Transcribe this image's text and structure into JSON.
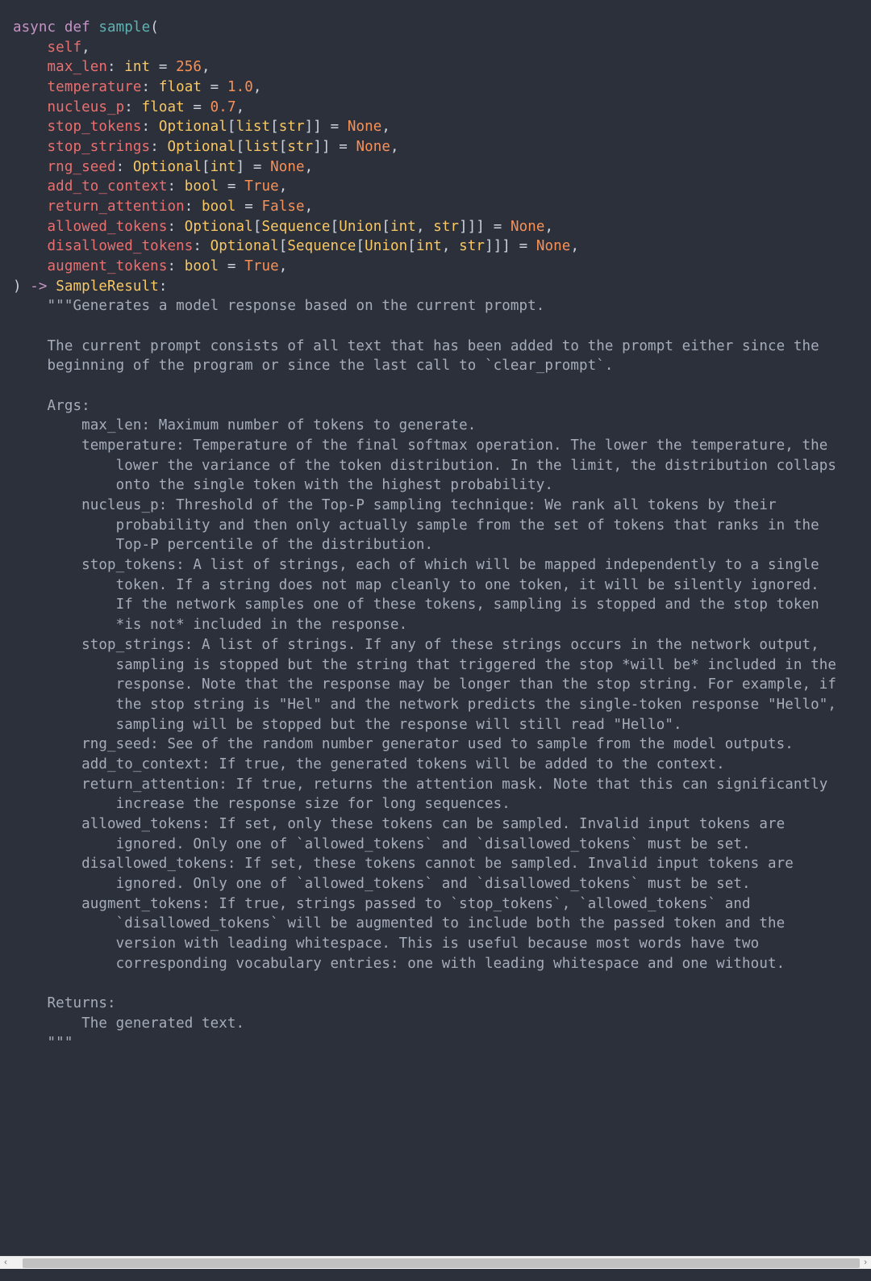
{
  "code": {
    "l1_async": "async",
    "l1_def": "def",
    "l1_fn": "sample",
    "l1_open": "(",
    "l2_self": "self",
    "l3_param": "max_len",
    "l3_type": "int",
    "l3_val": "256",
    "l4_param": "temperature",
    "l4_type": "float",
    "l4_val": "1.0",
    "l5_param": "nucleus_p",
    "l5_type": "float",
    "l5_val": "0.7",
    "l6_param": "stop_tokens",
    "l6_opt": "Optional",
    "l6_list": "list",
    "l6_str": "str",
    "l6_val": "None",
    "l7_param": "stop_strings",
    "l7_opt": "Optional",
    "l7_list": "list",
    "l7_str": "str",
    "l7_val": "None",
    "l8_param": "rng_seed",
    "l8_opt": "Optional",
    "l8_int": "int",
    "l8_val": "None",
    "l9_param": "add_to_context",
    "l9_type": "bool",
    "l9_val": "True",
    "l10_param": "return_attention",
    "l10_type": "bool",
    "l10_val": "False",
    "l11_param": "allowed_tokens",
    "l11_opt": "Optional",
    "l11_seq": "Sequence",
    "l11_union": "Union",
    "l11_int": "int",
    "l11_str": "str",
    "l11_val": "None",
    "l12_param": "disallowed_tokens",
    "l12_opt": "Optional",
    "l12_seq": "Sequence",
    "l12_union": "Union",
    "l12_int": "int",
    "l12_str": "str",
    "l12_val": "None",
    "l13_param": "augment_tokens",
    "l13_type": "bool",
    "l13_val": "True",
    "l14_close": ")",
    "l14_arrow": "->",
    "l14_ret": "SampleResult",
    "doc_open": "\"\"\"Generates a model response based on the current prompt.",
    "doc_p2a": "    The current prompt consists of all text that has been added to the prompt either since the",
    "doc_p2b": "    beginning of the program or since the last call to `clear_prompt`.",
    "doc_args": "    Args:",
    "doc_maxlen": "        max_len: Maximum number of tokens to generate.",
    "doc_temp1": "        temperature: Temperature of the final softmax operation. The lower the temperature, the",
    "doc_temp2": "            lower the variance of the token distribution. In the limit, the distribution collaps",
    "doc_temp3": "            onto the single token with the highest probability.",
    "doc_nuc1": "        nucleus_p: Threshold of the Top-P sampling technique: We rank all tokens by their",
    "doc_nuc2": "            probability and then only actually sample from the set of tokens that ranks in the",
    "doc_nuc3": "            Top-P percentile of the distribution.",
    "doc_st1": "        stop_tokens: A list of strings, each of which will be mapped independently to a single",
    "doc_st2": "            token. If a string does not map cleanly to one token, it will be silently ignored.",
    "doc_st3": "            If the network samples one of these tokens, sampling is stopped and the stop token",
    "doc_st4": "            *is not* included in the response.",
    "doc_ss1": "        stop_strings: A list of strings. If any of these strings occurs in the network output,",
    "doc_ss2": "            sampling is stopped but the string that triggered the stop *will be* included in the",
    "doc_ss3": "            response. Note that the response may be longer than the stop string. For example, if",
    "doc_ss4": "            the stop string is \"Hel\" and the network predicts the single-token response \"Hello\",",
    "doc_ss5": "            sampling will be stopped but the response will still read \"Hello\".",
    "doc_rng": "        rng_seed: See of the random number generator used to sample from the model outputs.",
    "doc_atc": "        add_to_context: If true, the generated tokens will be added to the context.",
    "doc_ra1": "        return_attention: If true, returns the attention mask. Note that this can significantly",
    "doc_ra2": "            increase the response size for long sequences.",
    "doc_at1": "        allowed_tokens: If set, only these tokens can be sampled. Invalid input tokens are",
    "doc_at2": "            ignored. Only one of `allowed_tokens` and `disallowed_tokens` must be set.",
    "doc_dt1": "        disallowed_tokens: If set, these tokens cannot be sampled. Invalid input tokens are",
    "doc_dt2": "            ignored. Only one of `allowed_tokens` and `disallowed_tokens` must be set.",
    "doc_aug1": "        augment_tokens: If true, strings passed to `stop_tokens`, `allowed_tokens` and",
    "doc_aug2": "            `disallowed_tokens` will be augmented to include both the passed token and the",
    "doc_aug3": "            version with leading whitespace. This is useful because most words have two",
    "doc_aug4": "            corresponding vocabulary entries: one with leading whitespace and one without.",
    "doc_returns": "    Returns:",
    "doc_ret1": "        The generated text.",
    "doc_close": "    \"\"\""
  }
}
